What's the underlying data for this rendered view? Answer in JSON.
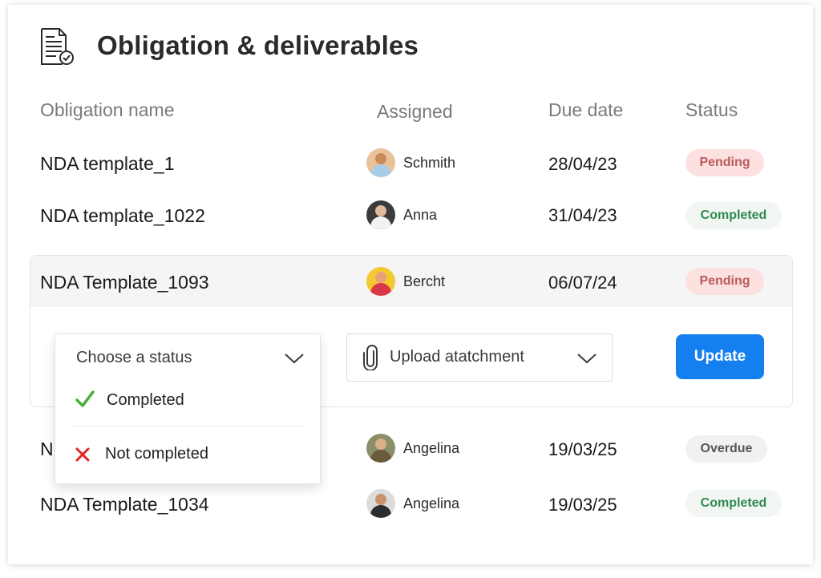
{
  "header": {
    "title": "Obligation & deliverables",
    "icon": "document-check-icon"
  },
  "columns": {
    "name": "Obligation name",
    "assigned": "Assigned",
    "due": "Due date",
    "status": "Status"
  },
  "rows": [
    {
      "name": "NDA template_1",
      "assignee": "Schmith",
      "due": "28/04/23",
      "status": "Pending"
    },
    {
      "name": "NDA template_1022",
      "assignee": "Anna",
      "due": "31/04/23",
      "status": "Completed"
    },
    {
      "name": "NDA Template_1093",
      "assignee": "Bercht",
      "due": "06/07/24",
      "status": "Pending"
    },
    {
      "name": "N",
      "assignee": "Angelina",
      "due": "19/03/25",
      "status": "Overdue"
    },
    {
      "name": "NDA Template_1034",
      "assignee": "Angelina",
      "due": "19/03/25",
      "status": "Completed"
    }
  ],
  "editor": {
    "status_select": {
      "placeholder": "Choose a status",
      "options": [
        "Completed",
        "Not completed"
      ]
    },
    "upload": {
      "label": "Upload atatchment"
    },
    "update_label": "Update"
  },
  "colors": {
    "accent": "#1480f0",
    "pending": "#fde0e0",
    "completed_text": "#2f8a4f",
    "check": "#4caf3a",
    "cross": "#e02424"
  }
}
